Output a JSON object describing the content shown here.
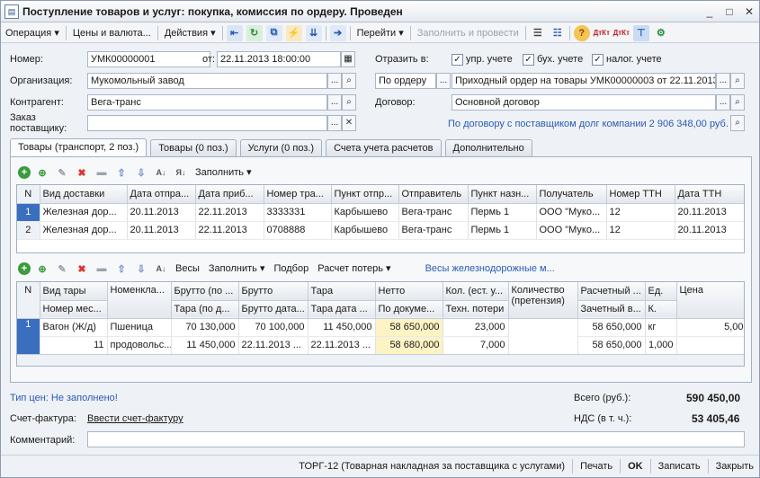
{
  "window": {
    "title": "Поступление товаров и услуг: покупка, комиссия по ордеру. Проведен",
    "app_icon": "document-icon"
  },
  "toolbar": {
    "operation": "Операция",
    "prices": "Цены и валюта...",
    "actions": "Действия",
    "goto": "Перейти",
    "fill_post": "Заполнить и провести"
  },
  "header": {
    "number_label": "Номер:",
    "number": "УМК00000001",
    "from_label": "от:",
    "date": "22.11.2013 18:00:00",
    "reflect_label": "Отразить в:",
    "chk_mgmt": "упр. учете",
    "chk_acc": "бух. учете",
    "chk_tax": "налог. учете",
    "org_label": "Организация:",
    "org": "Мукомольный завод",
    "order_type": "По ордеру",
    "order_doc": "Приходный ордер на товары УМК00000003 от 22.11.2013",
    "contractor_label": "Контрагент:",
    "contractor": "Вега-транс",
    "contract_label": "Договор:",
    "contract": "Основной договор",
    "supplier_order_label": "Заказ поставщику:",
    "supplier_order": "",
    "debt_link": "По договору с поставщиком долг компании 2 906 348,00 руб."
  },
  "tabs": [
    "Товары (транспорт, 2 поз.)",
    "Товары (0 поз.)",
    "Услуги (0 поз.)",
    "Счета учета расчетов",
    "Дополнительно"
  ],
  "grid1": {
    "fill": "Заполнить",
    "columns": [
      "N",
      "Вид доставки",
      "Дата отпра...",
      "Дата приб...",
      "Номер тра...",
      "Пункт отпр...",
      "Отправитель",
      "Пункт назн...",
      "Получатель",
      "Номер ТТН",
      "Дата ТТН"
    ],
    "rows": [
      [
        "1",
        "Железная дор...",
        "20.11.2013",
        "22.11.2013",
        "3333331",
        "Карбышево",
        "Вега-транс",
        "Пермь 1",
        "ООО \"Муко...",
        "12",
        "20.11.2013"
      ],
      [
        "2",
        "Железная дор...",
        "20.11.2013",
        "22.11.2013",
        "0708888",
        "Карбышево",
        "Вега-транс",
        "Пермь 1",
        "ООО \"Муко...",
        "12",
        "20.11.2013"
      ]
    ]
  },
  "grid2": {
    "weights": "Весы",
    "fill": "Заполнить",
    "select": "Подбор",
    "loss": "Расчет потерь",
    "rail_link": "Весы железнодорожные м...",
    "head1": [
      "N",
      "Вид тары",
      "Номенкла...",
      "Брутто (по ...",
      "Брутто",
      "Тара",
      "Нетто",
      "Кол. (ест. у...",
      "Количество (претензия)",
      "Расчетный ...",
      "Ед.",
      "Цена"
    ],
    "head2": [
      "Номер мес...",
      "Тара  (по д...",
      "Брутто дата...",
      "Тара дата ...",
      "По докуме...",
      "Техн. потери",
      "Зачетный в...",
      "К."
    ],
    "row_num": "1",
    "r1": {
      "tara": "Вагон (Ж/д)",
      "nom": "Пшеница",
      "brutto_doc": "70 130,000",
      "brutto": "70 100,000",
      "tara_w": "11 450,000",
      "netto": "58 650,000",
      "qty": "23,000",
      "calc": "58 650,000",
      "unit": "кг",
      "price": "5,00"
    },
    "r2": {
      "place": "11",
      "nom": "продовольс...",
      "tara_doc": "11 450,000",
      "brutto_date": "22.11.2013 ...",
      "tara_date": "22.11.2013 ...",
      "netto_doc": "58 680,000",
      "tech_loss": "7,000",
      "credit": "58 650,000",
      "k": "1,000"
    }
  },
  "bottom": {
    "price_type": "Тип цен: Не заполнено!",
    "total_label": "Всего (руб.):",
    "total": "590 450,00",
    "invoice_label": "Счет-фактура:",
    "invoice_link": "Ввести счет-фактуру",
    "vat_label": "НДС (в т. ч.):",
    "vat": "53 405,46",
    "comment_label": "Комментарий:",
    "comment": ""
  },
  "footer": {
    "torg": "ТОРГ-12 (Товарная накладная за поставщика с услугами)",
    "print": "Печать",
    "ok": "OK",
    "save": "Записать",
    "close": "Закрыть"
  }
}
